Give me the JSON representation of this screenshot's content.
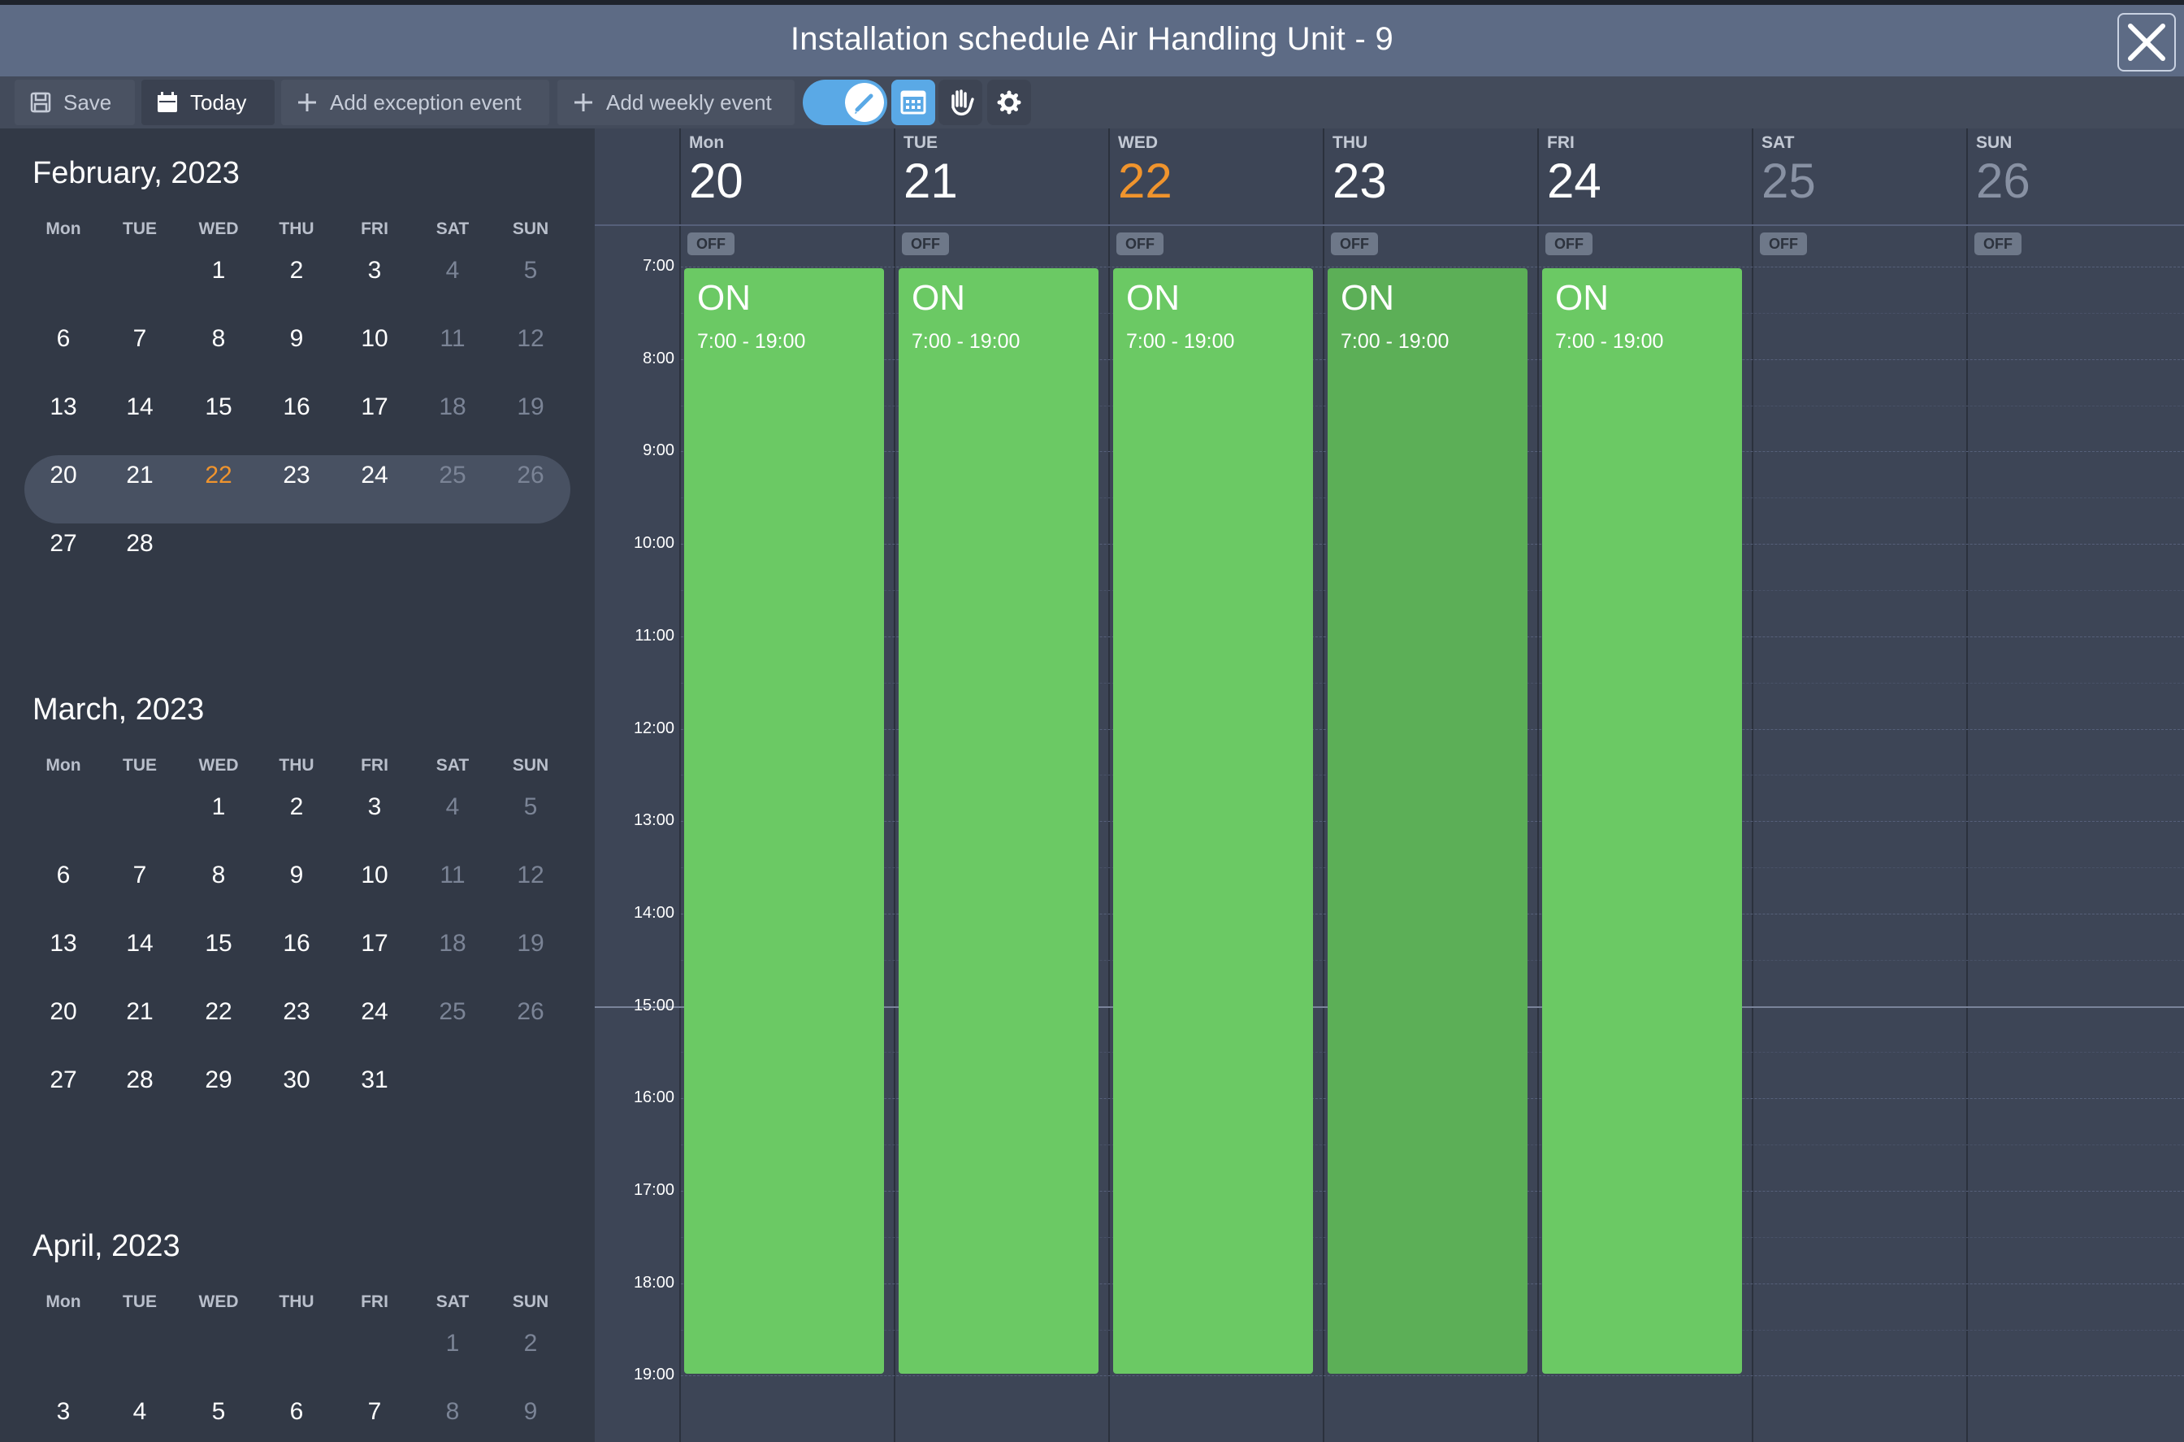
{
  "window": {
    "title": "Installation schedule Air Handling Unit - 9"
  },
  "toolbar": {
    "save_label": "Save",
    "today_label": "Today",
    "add_exception_label": "Add exception event",
    "add_weekly_label": "Add weekly event"
  },
  "sidebar": {
    "dow": [
      "Mon",
      "TUE",
      "WED",
      "THU",
      "FRI",
      "SAT",
      "SUN"
    ],
    "months": [
      {
        "title": "February, 2023",
        "weeks": [
          [
            "",
            "",
            "1",
            "2",
            "3",
            "4",
            "5"
          ],
          [
            "6",
            "7",
            "8",
            "9",
            "10",
            "11",
            "12"
          ],
          [
            "13",
            "14",
            "15",
            "16",
            "17",
            "18",
            "19"
          ],
          [
            "20",
            "21",
            "22",
            "23",
            "24",
            "25",
            "26"
          ],
          [
            "27",
            "28",
            "",
            "",
            "",
            "",
            ""
          ]
        ]
      },
      {
        "title": "March, 2023",
        "weeks": [
          [
            "",
            "",
            "1",
            "2",
            "3",
            "4",
            "5"
          ],
          [
            "6",
            "7",
            "8",
            "9",
            "10",
            "11",
            "12"
          ],
          [
            "13",
            "14",
            "15",
            "16",
            "17",
            "18",
            "19"
          ],
          [
            "20",
            "21",
            "22",
            "23",
            "24",
            "25",
            "26"
          ],
          [
            "27",
            "28",
            "29",
            "30",
            "31",
            "",
            ""
          ]
        ]
      },
      {
        "title": "April, 2023",
        "weeks": [
          [
            "",
            "",
            "",
            "",
            "",
            "1",
            "2"
          ],
          [
            "3",
            "4",
            "5",
            "6",
            "7",
            "8",
            "9"
          ]
        ]
      }
    ]
  },
  "week": {
    "days": [
      {
        "name": "Mon",
        "num": "20"
      },
      {
        "name": "TUE",
        "num": "21"
      },
      {
        "name": "WED",
        "num": "22"
      },
      {
        "name": "THU",
        "num": "23"
      },
      {
        "name": "FRI",
        "num": "24"
      },
      {
        "name": "SAT",
        "num": "25"
      },
      {
        "name": "SUN",
        "num": "26"
      }
    ],
    "off_label": "OFF",
    "times": [
      "7:00",
      "8:00",
      "9:00",
      "10:00",
      "11:00",
      "12:00",
      "13:00",
      "14:00",
      "15:00",
      "16:00",
      "17:00",
      "18:00",
      "19:00"
    ],
    "events": [
      {
        "title": "ON",
        "time": "7:00 - 19:00"
      },
      {
        "title": "ON",
        "time": "7:00 - 19:00"
      },
      {
        "title": "ON",
        "time": "7:00 - 19:00"
      },
      {
        "title": "ON",
        "time": "7:00 - 19:00"
      },
      {
        "title": "ON",
        "time": "7:00 - 19:00"
      }
    ]
  },
  "colors": {
    "accent": "#5aa9e6",
    "today": "#f0942d",
    "event": "#6bc964",
    "event_selected": "#5caf57"
  },
  "icons": {
    "save": "save-icon",
    "today": "calendar-icon",
    "add": "plus-icon",
    "close": "close-icon",
    "edit": "pencil-icon",
    "settings": "gear-icon",
    "manual": "hand-icon"
  }
}
